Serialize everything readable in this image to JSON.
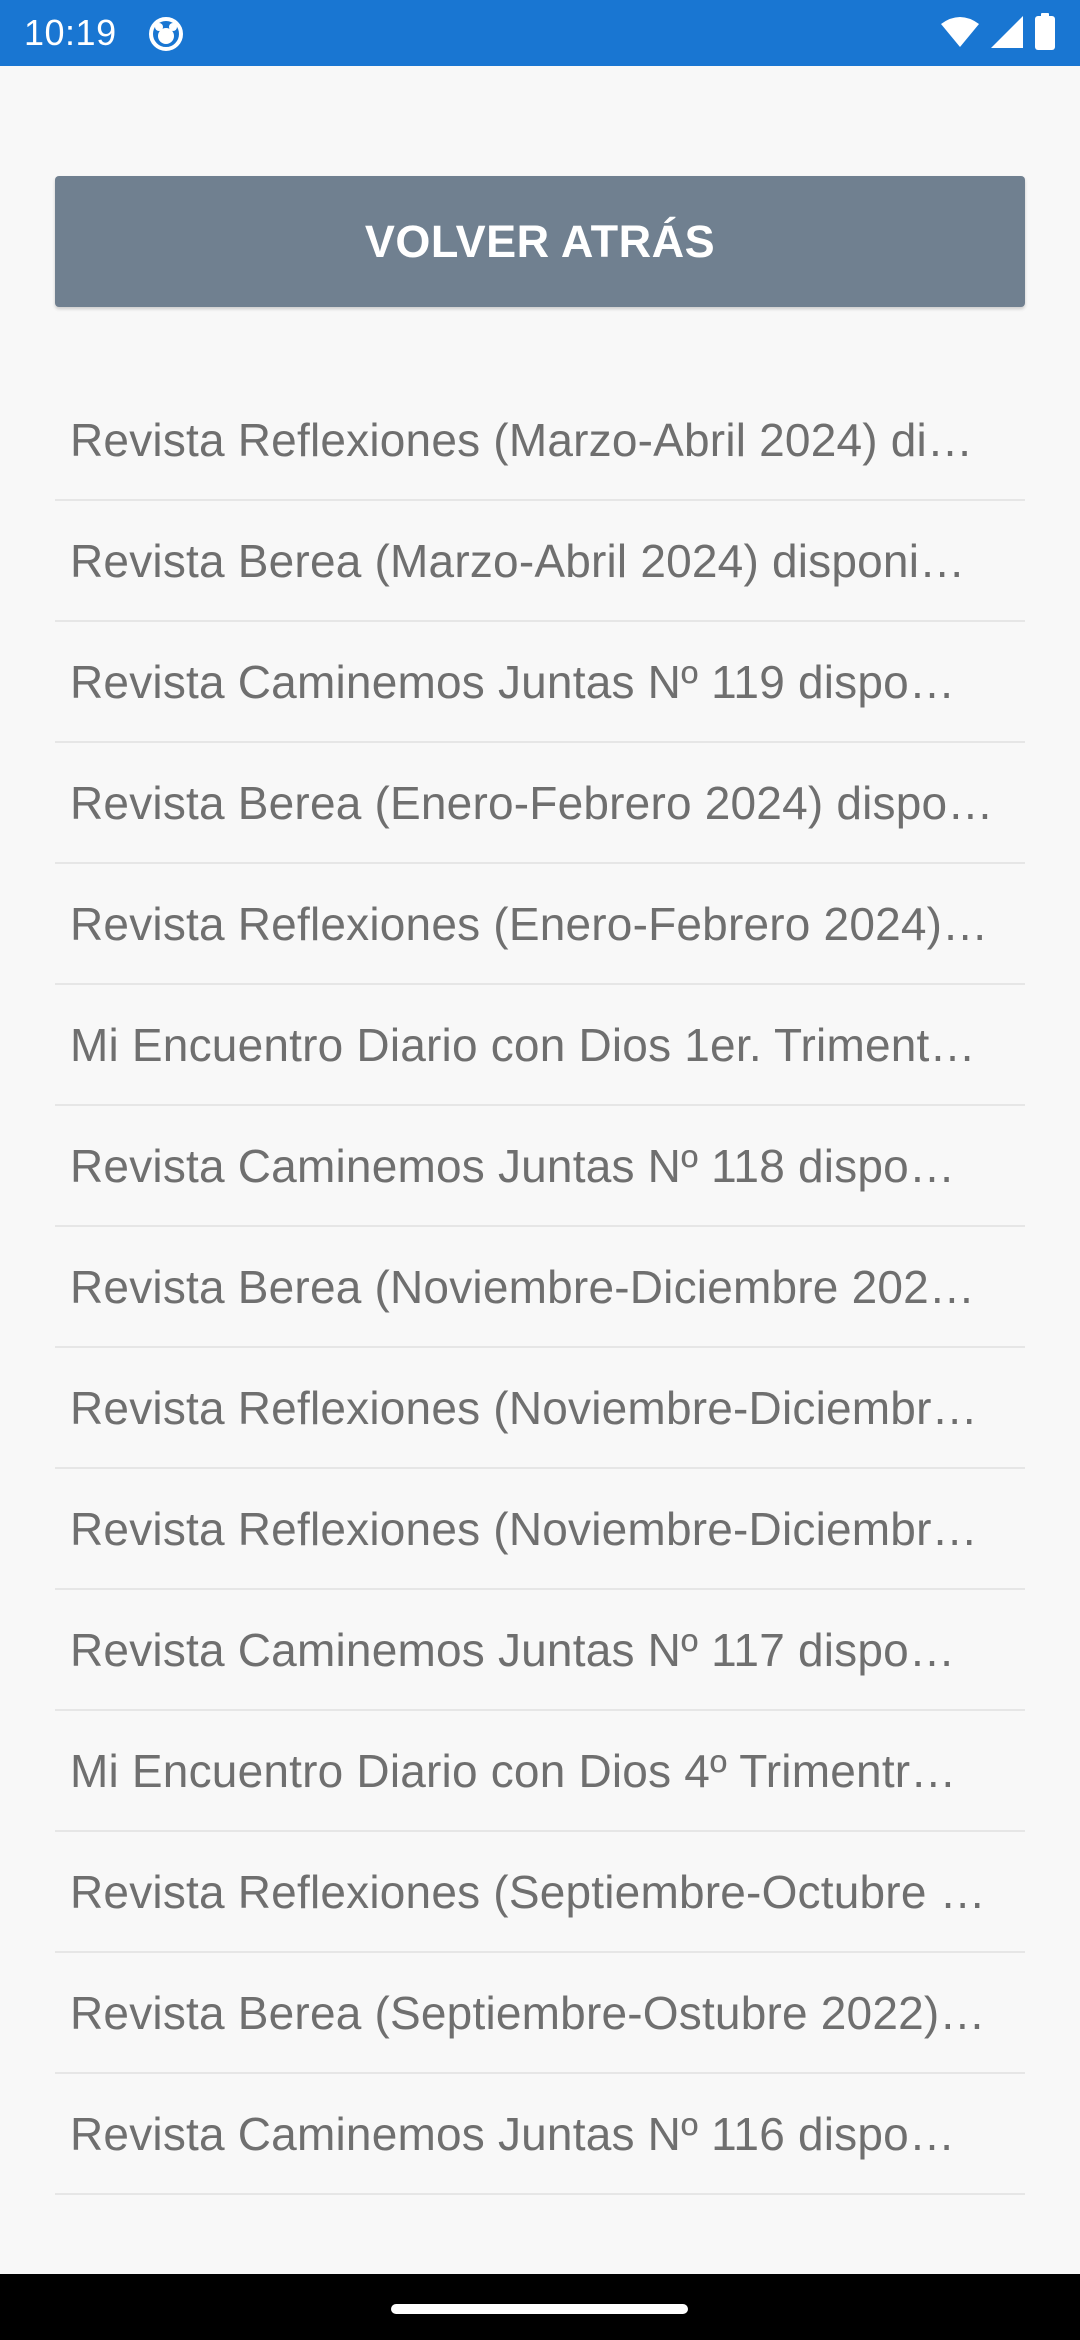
{
  "status_bar": {
    "time": "10:19",
    "color": "#1976d2",
    "app_icon": "app-notification-icon",
    "icons": [
      "wifi-icon",
      "signal-icon",
      "battery-icon"
    ]
  },
  "back_button": {
    "label": "VOLVER ATRÁS",
    "color": "#708090"
  },
  "list": {
    "items": [
      {
        "label": "Revista Reflexiones (Marzo-Abril 2024) di…"
      },
      {
        "label": "Revista Berea (Marzo-Abril 2024) disponi…"
      },
      {
        "label": "Revista Caminemos Juntas Nº 119 dispo…"
      },
      {
        "label": "Revista Berea (Enero-Febrero 2024) dispo…"
      },
      {
        "label": "Revista Reflexiones (Enero-Febrero 2024)…"
      },
      {
        "label": "Mi Encuentro Diario con Dios 1er. Triment…"
      },
      {
        "label": "Revista Caminemos Juntas Nº 118 dispo…"
      },
      {
        "label": "Revista Berea (Noviembre-Diciembre 202…"
      },
      {
        "label": "Revista Reflexiones (Noviembre-Diciembr…"
      },
      {
        "label": "Revista Reflexiones (Noviembre-Diciembr…"
      },
      {
        "label": "Revista Caminemos Juntas Nº 117 dispo…"
      },
      {
        "label": "Mi Encuentro Diario con Dios 4º Trimentr…"
      },
      {
        "label": "Revista Reflexiones (Septiembre-Octubre …"
      },
      {
        "label": "Revista Berea (Septiembre-Ostubre 2022)…"
      },
      {
        "label": "Revista Caminemos Juntas Nº 116 dispo…"
      }
    ]
  }
}
